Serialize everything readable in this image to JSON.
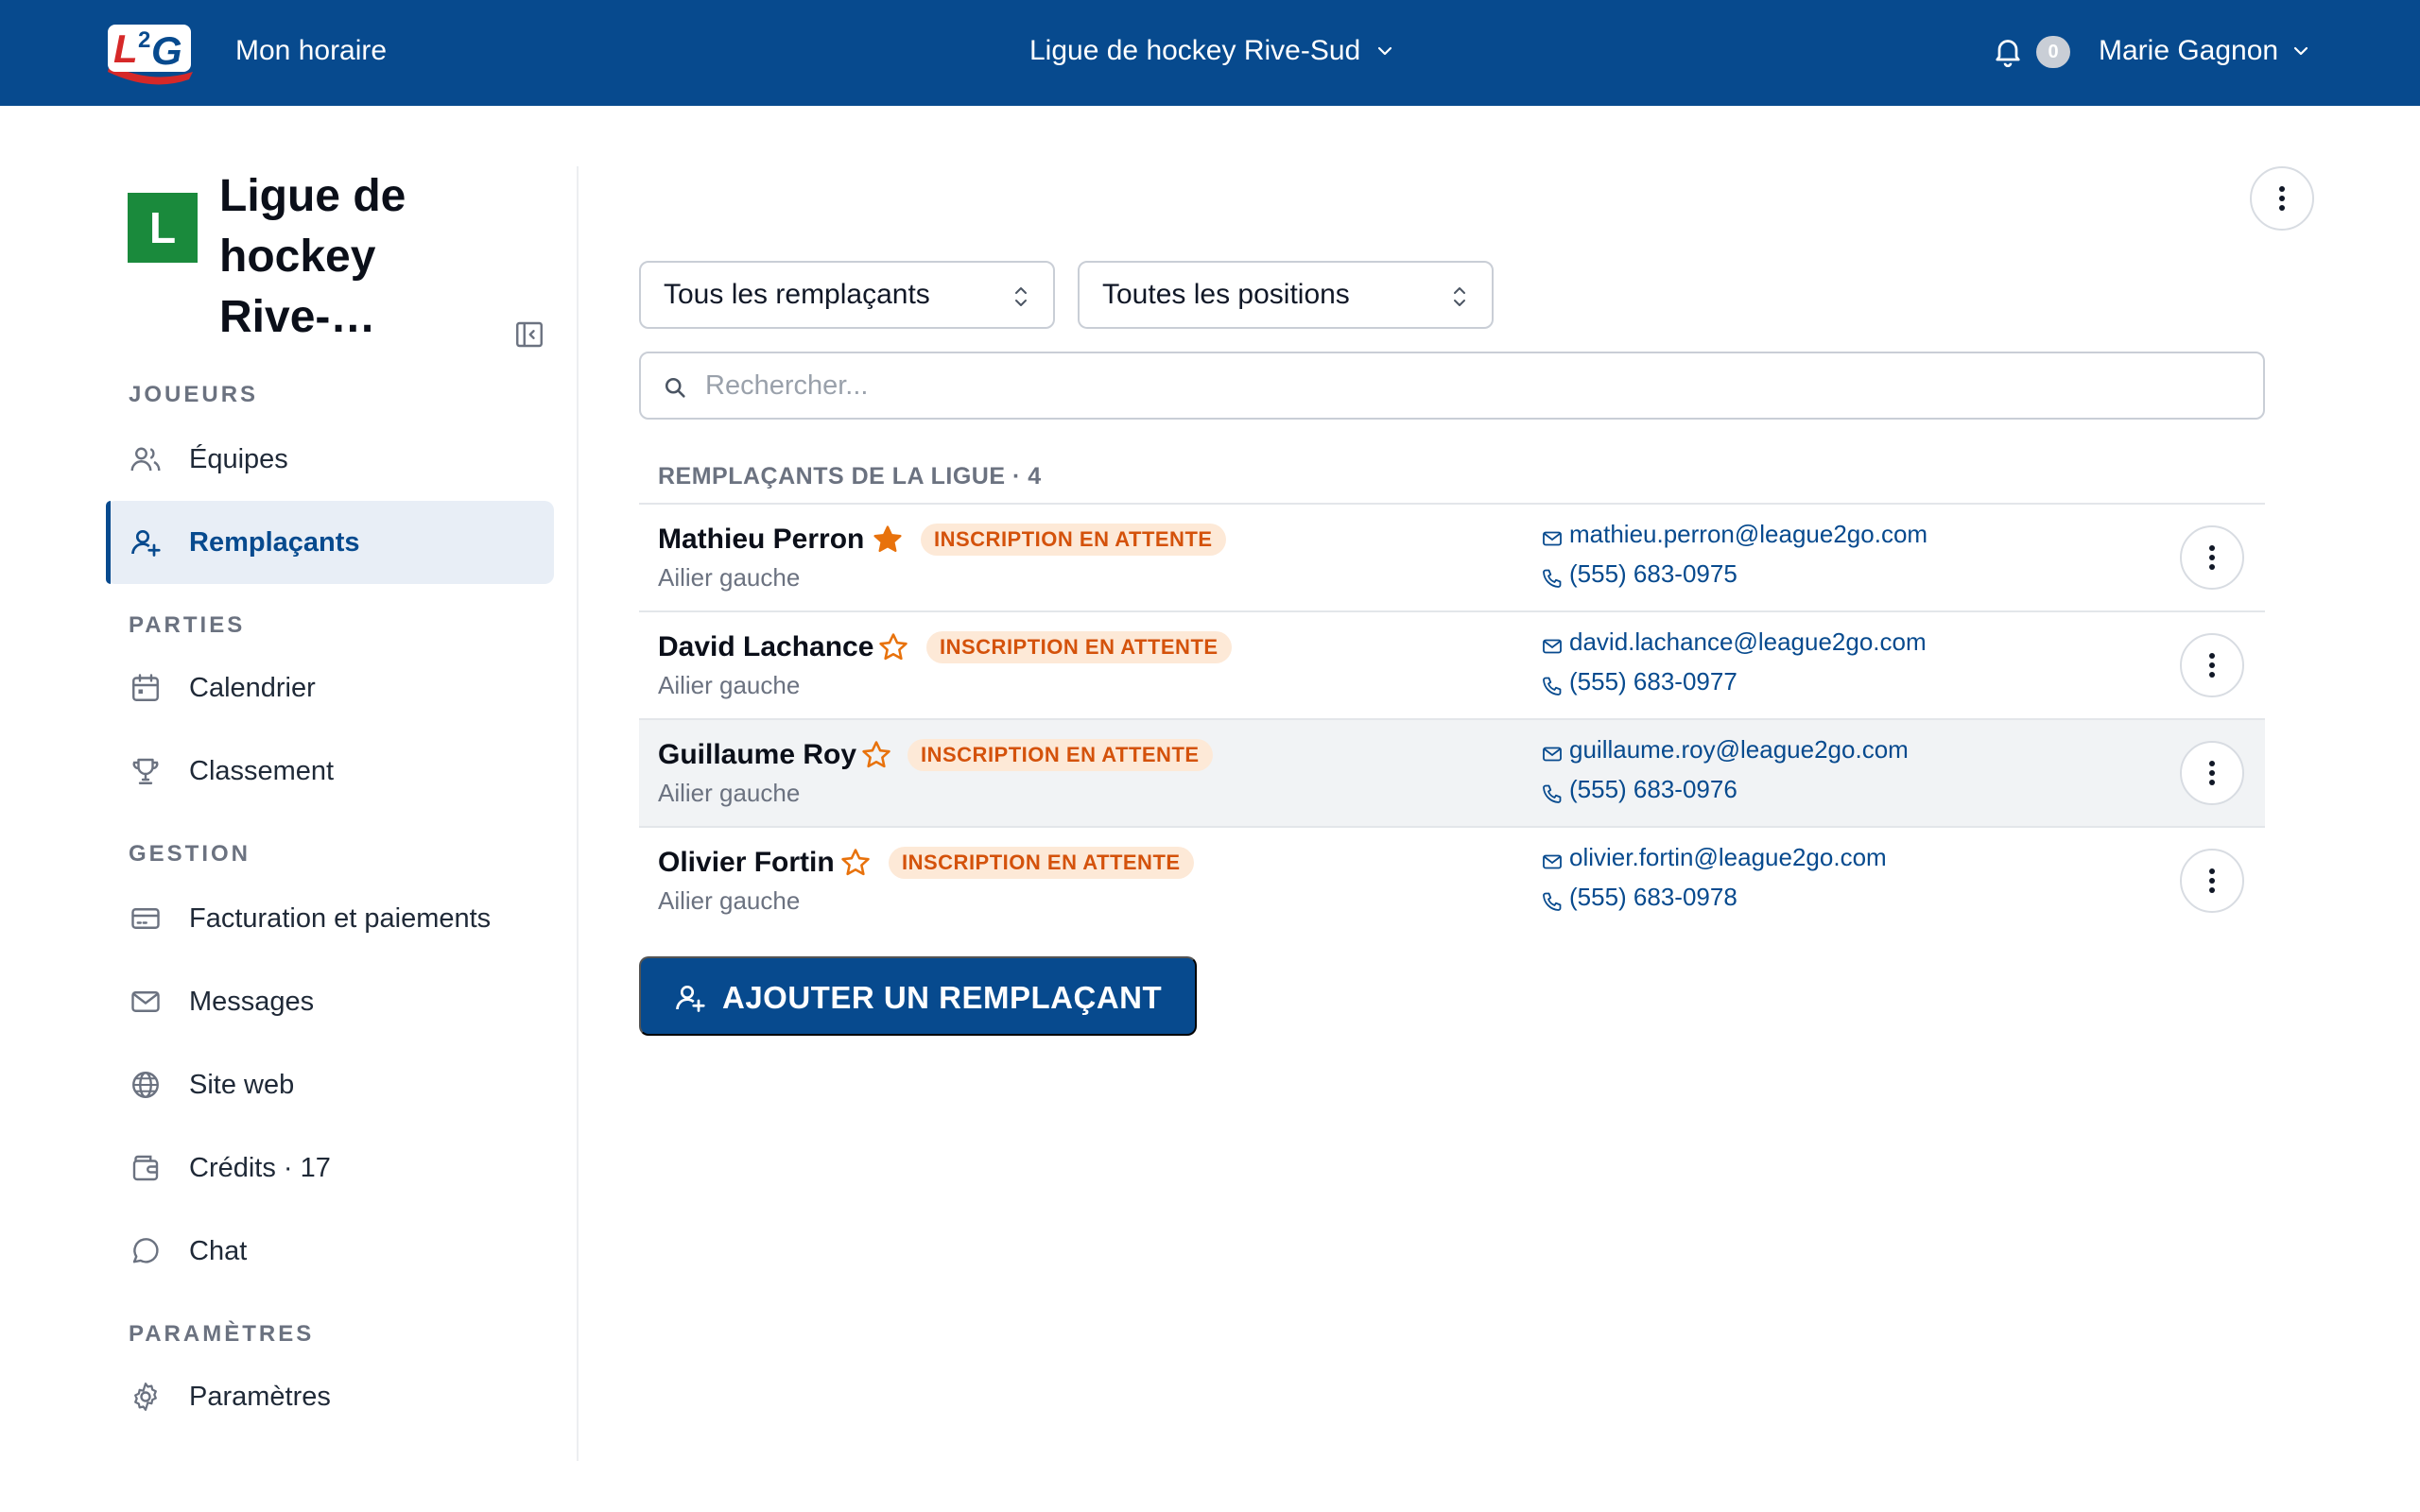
{
  "topbar": {
    "logo_text": "L2G",
    "schedule_link": "Mon horaire",
    "league_selector": "Ligue de hockey Rive-Sud",
    "notification_count": "0",
    "user_name": "Marie Gagnon"
  },
  "sidebar": {
    "org_initial": "L",
    "org_name": "Ligue de hockey Rive-…",
    "sections": {
      "players": "JOUEURS",
      "games": "PARTIES",
      "management": "GESTION",
      "settings": "PARAMÈTRES"
    },
    "items": {
      "teams": "Équipes",
      "substitutes": "Remplaçants",
      "calendar": "Calendrier",
      "standings": "Classement",
      "billing": "Facturation et paiements",
      "messages": "Messages",
      "website": "Site web",
      "credits": "Crédits · 17",
      "chat": "Chat",
      "settings": "Paramètres"
    }
  },
  "filters": {
    "substitutes_filter": "Tous les remplaçants",
    "positions_filter": "Toutes les positions",
    "search_placeholder": "Rechercher..."
  },
  "list": {
    "header": "REMPLAÇANTS DE LA LIGUE · 4",
    "rows": [
      {
        "name": "Mathieu Perron",
        "starred": true,
        "status": "INSCRIPTION EN ATTENTE",
        "position": "Ailier gauche",
        "email": "mathieu.perron@league2go.com",
        "phone": "(555) 683-0975"
      },
      {
        "name": "David Lachance",
        "starred": false,
        "status": "INSCRIPTION EN ATTENTE",
        "position": "Ailier gauche",
        "email": "david.lachance@league2go.com",
        "phone": "(555) 683-0977"
      },
      {
        "name": "Guillaume Roy",
        "starred": false,
        "status": "INSCRIPTION EN ATTENTE",
        "position": "Ailier gauche",
        "email": "guillaume.roy@league2go.com",
        "phone": "(555) 683-0976"
      },
      {
        "name": "Olivier Fortin",
        "starred": false,
        "status": "INSCRIPTION EN ATTENTE",
        "position": "Ailier gauche",
        "email": "olivier.fortin@league2go.com",
        "phone": "(555) 683-0978"
      }
    ]
  },
  "actions": {
    "add_substitute": "AJOUTER UN REMPLAÇANT"
  },
  "colors": {
    "brand": "#074a8e",
    "org_avatar": "#1a8a3c",
    "star": "#e8720c",
    "badge_bg": "#fde9d7",
    "badge_text": "#d4520b"
  },
  "icons": [
    "l2g-logo",
    "chevron-down-icon",
    "bell-icon",
    "more-vertical-icon",
    "sidebar-collapse-icon",
    "users-icon",
    "user-plus-icon",
    "calendar-icon",
    "trophy-icon",
    "credit-card-icon",
    "mail-icon",
    "globe-icon",
    "wallet-icon",
    "chat-bubble-icon",
    "gear-icon",
    "updown-chevron-icon",
    "search-icon",
    "star-icon",
    "phone-icon"
  ]
}
